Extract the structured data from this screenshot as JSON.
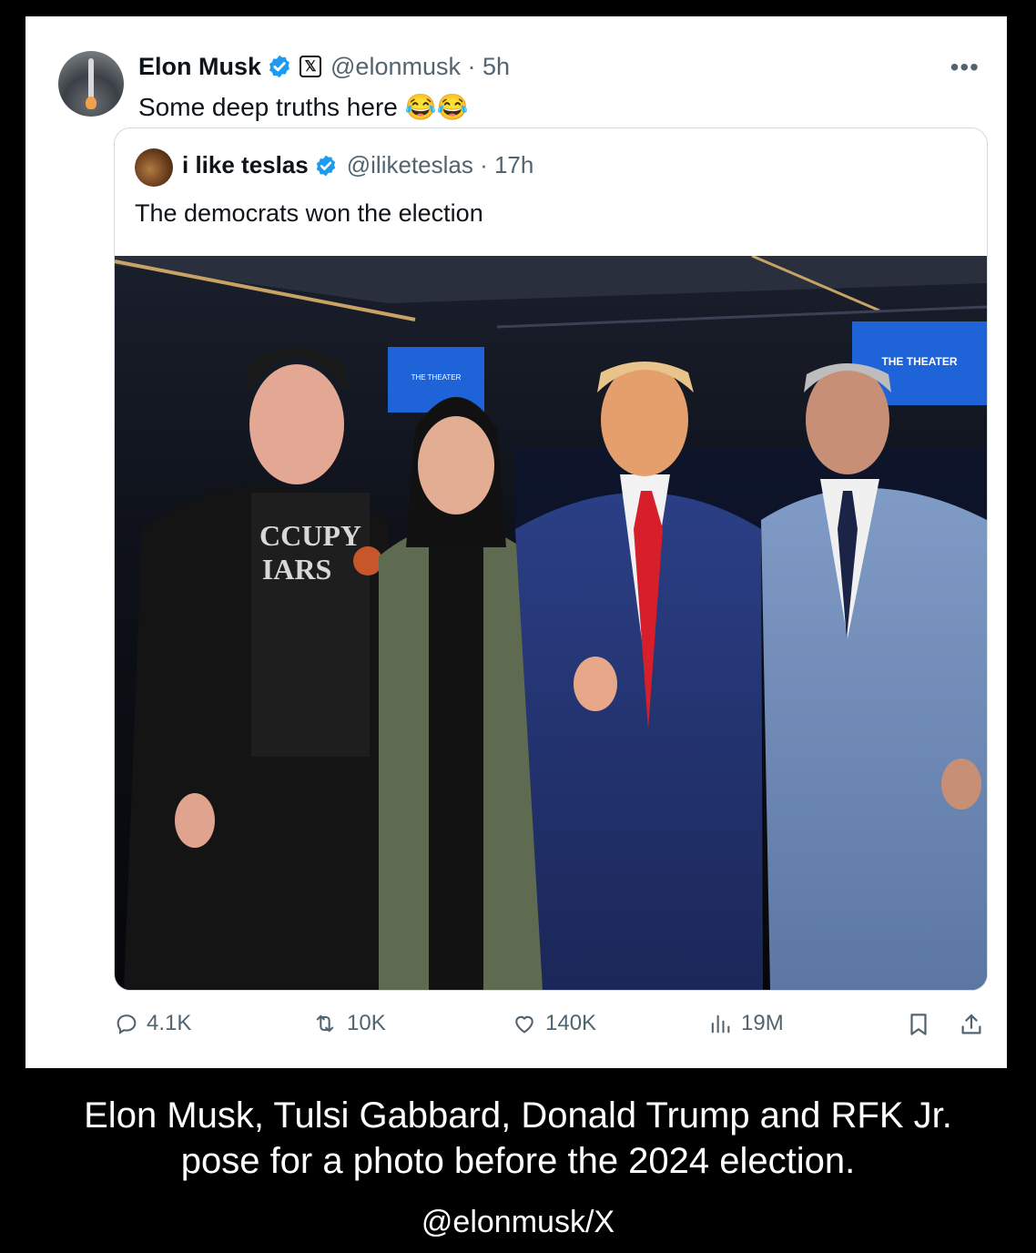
{
  "tweet": {
    "author_name": "Elon Musk",
    "author_handle": "@elonmusk · 5h",
    "affiliation_badge": "𝕏",
    "more_icon": "more-horizontal-icon",
    "text": "Some deep truths here 😂😂"
  },
  "quoted": {
    "author_name": "i like teslas",
    "author_handle": "@iliketeslas · 17h",
    "text": "The democrats won the election",
    "photo": {
      "sign_left": "THE THEATER",
      "sign_right": "THE THEATER",
      "shirt_text_1": "CCUPY",
      "shirt_text_2": "IARS"
    }
  },
  "actions": {
    "replies": "4.1K",
    "reposts": "10K",
    "likes": "140K",
    "views": "19M"
  },
  "colors": {
    "verified_blue": "#1d9bf0",
    "muted": "#536471",
    "text": "#0f1419"
  },
  "caption": {
    "line1": "Elon Musk, Tulsi Gabbard, Donald Trump and RFK Jr.",
    "line2": "pose for a photo before the 2024 election.",
    "credit": "@elonmusk/X"
  }
}
